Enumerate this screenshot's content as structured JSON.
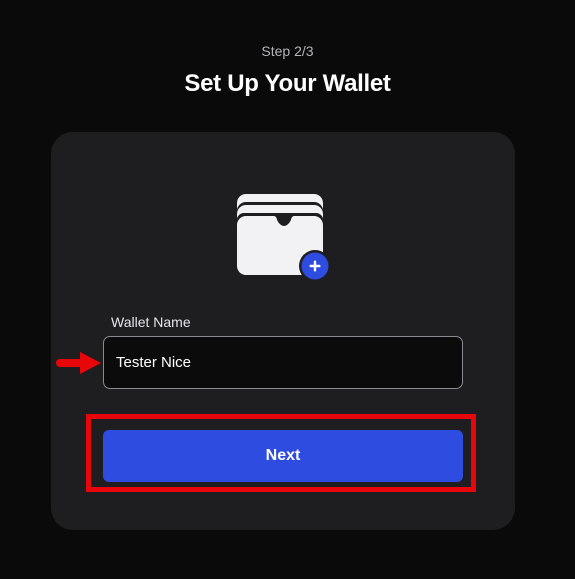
{
  "header": {
    "step": "Step 2/3",
    "title": "Set Up Your Wallet"
  },
  "card": {
    "icon": "wallet-add-icon",
    "wallet_name_label": "Wallet Name",
    "wallet_name_value": "Tester Nice",
    "next_label": "Next"
  },
  "annotations": {
    "arrow_color": "#e8060a",
    "highlight_color": "#e8060a"
  },
  "colors": {
    "background": "#0a0a0a",
    "card": "#1e1e21",
    "accent": "#2e4ce0"
  }
}
